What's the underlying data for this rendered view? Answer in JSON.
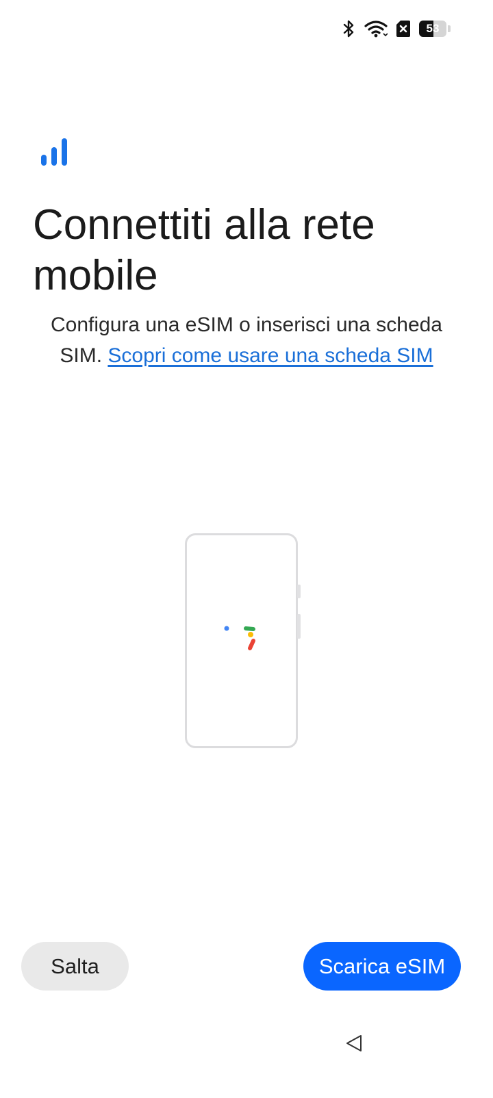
{
  "status_bar": {
    "battery_level": "53",
    "battery_percent": 53,
    "icons": [
      "bluetooth-icon",
      "wifi-icon",
      "no-sim-icon",
      "battery-icon"
    ]
  },
  "header": {
    "icon": "cellular-signal-icon",
    "title": "Connettiti alla rete mobile"
  },
  "body": {
    "description_prefix": "Configura una eSIM o inserisci una scheda SIM. ",
    "learn_more_link": "Scopri come usare una scheda SIM",
    "illustration": "phone-loading-illustration"
  },
  "actions": {
    "skip_label": "Salta",
    "download_esim_label": "Scarica eSIM"
  },
  "navigation": {
    "back_icon": "back-triangle-icon"
  },
  "colors": {
    "accent": "#0a66ff",
    "link": "#1a6fd8",
    "signal_icon": "#1a73e8",
    "secondary_button": "#e9e9e9"
  }
}
